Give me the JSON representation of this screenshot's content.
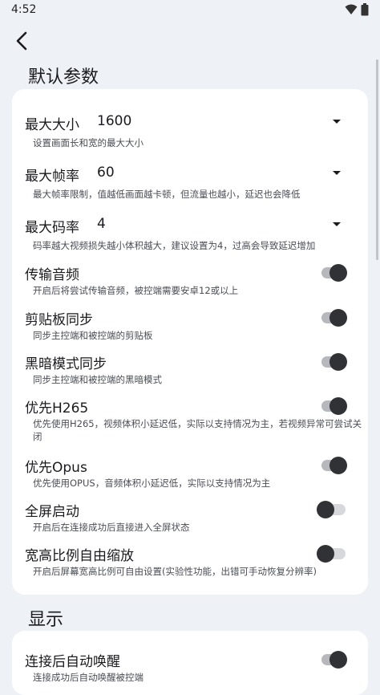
{
  "status": {
    "time": "4:52"
  },
  "sections": {
    "defaults": "默认参数",
    "display": "显示"
  },
  "settings": [
    {
      "title": "最大大小",
      "value": "1600",
      "desc": "设置画面长和宽的最大大小",
      "type": "dropdown"
    },
    {
      "title": "最大帧率",
      "value": "60",
      "desc": "最大帧率限制，值越低画面越卡顿，但流量也越小，延迟也会降低",
      "type": "dropdown"
    },
    {
      "title": "最大码率",
      "value": "4",
      "desc": "码率越大视频损失越小体积越大，建议设置为4，过高会导致延迟增加",
      "type": "dropdown"
    },
    {
      "title": "传输音频",
      "desc": "开启后将尝试传输音频，被控端需要安卓12或以上",
      "type": "switch",
      "on": true
    },
    {
      "title": "剪贴板同步",
      "desc": "同步主控端和被控端的剪贴板",
      "type": "switch",
      "on": true
    },
    {
      "title": "黑暗模式同步",
      "desc": "同步主控端和被控端的黑暗模式",
      "type": "switch",
      "on": true
    },
    {
      "title": "优先H265",
      "desc": "优先使用H265，视频体积小延迟低，实际以支持情况为主，若视频异常可尝试关闭",
      "type": "switch",
      "on": true
    },
    {
      "title": "优先Opus",
      "desc": "优先使用OPUS，音频体积小延迟低，实际以支持情况为主",
      "type": "switch",
      "on": true
    },
    {
      "title": "全屏启动",
      "desc": "开启后在连接成功后直接进入全屏状态",
      "type": "switch",
      "on": false
    },
    {
      "title": "宽高比例自由缩放",
      "desc": "开启后屏幕宽高比例可自由设置(实验性功能，出错可手动恢复分辨率)",
      "type": "switch",
      "on": false
    }
  ],
  "display_settings": [
    {
      "title": "连接后自动唤醒",
      "desc": "连接成功后自动唤醒被控端",
      "type": "switch",
      "on": true
    }
  ]
}
